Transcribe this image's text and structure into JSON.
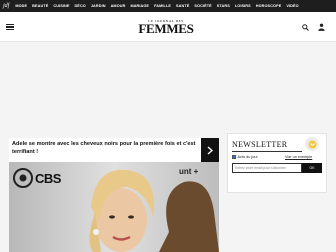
{
  "topnav": {
    "logo": "jdf",
    "items": [
      "MODE",
      "BEAUTÉ",
      "CUISINE",
      "DÉCO",
      "JARDIN",
      "AMOUR",
      "MARIAGE",
      "FAMILLE",
      "SANTÉ",
      "SOCIÉTÉ",
      "STARS",
      "LOISIRS",
      "HOROSCOPE",
      "VIDÉO"
    ]
  },
  "header": {
    "brand_small": "LE JOURNAL DES",
    "brand_big": "FEMMES"
  },
  "feature": {
    "title": "Adele se montre avec les cheveux noirs pour la première fois et c'est terrifiant !",
    "image_text": "CBS"
  },
  "newsletter": {
    "title": "NEWSLETTER",
    "checkbox_label": "Actu du jour",
    "example_link": "Voir un exemple",
    "input_placeholder": "Entrez votre email pour s'abonner",
    "button_label": "OK"
  },
  "colors": {
    "topnav_bg": "#1e1e1e",
    "accent_dark": "#111111"
  }
}
